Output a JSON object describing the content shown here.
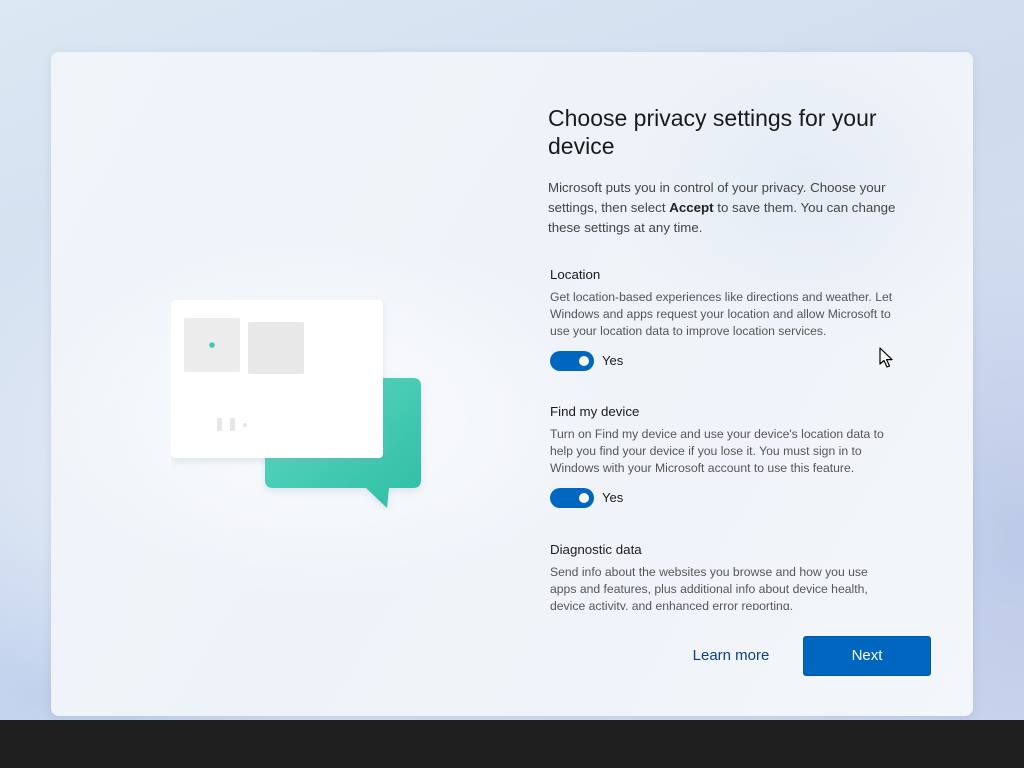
{
  "page": {
    "title": "Choose privacy settings for your device",
    "intro_before": "Microsoft puts you in control of your privacy. Choose your settings, then select ",
    "intro_bold": "Accept",
    "intro_after": " to save them. You can change these settings at any time."
  },
  "settings": [
    {
      "title": "Location",
      "description": "Get location-based experiences like directions and weather. Let Windows and apps request your location and allow Microsoft to use your location data to improve location services.",
      "toggle_state": "on",
      "toggle_label": "Yes"
    },
    {
      "title": "Find my device",
      "description": "Turn on Find my device and use your device's location data to help you find your device if you lose it. You must sign in to Windows with your Microsoft account to use this feature.",
      "toggle_state": "on",
      "toggle_label": "Yes"
    },
    {
      "title": "Diagnostic data",
      "description": "Send info about the websites you browse and how you use apps and features, plus additional info about device health, device activity, and enhanced error reporting."
    }
  ],
  "footer": {
    "learn_more_label": "Learn more",
    "next_label": "Next"
  },
  "colors": {
    "accent": "#0067c0",
    "teal": "#3fcbb0",
    "taskbar": "#1f1f1f"
  },
  "icons": {
    "cursor": "arrow-cursor-icon",
    "illustration": "privacy-chat-illustration"
  }
}
